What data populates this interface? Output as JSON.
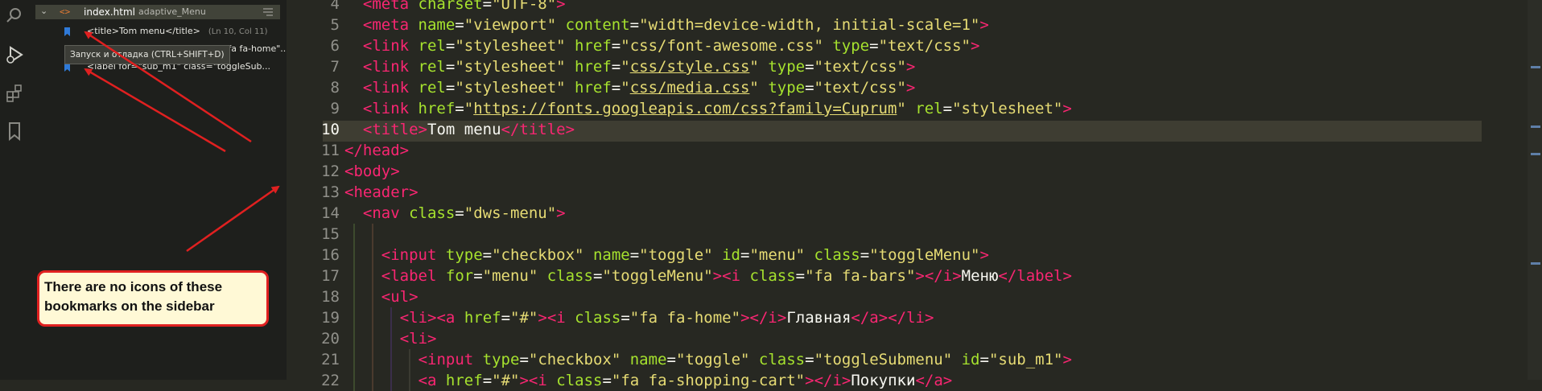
{
  "activity_bar": {
    "icons": [
      "search-icon",
      "run-debug-icon",
      "extensions-icon",
      "bookmarks-icon"
    ]
  },
  "bookmarks_panel": {
    "file": {
      "name": "index.html",
      "folder": "adaptive_Menu"
    },
    "items": [
      {
        "text": "<title>Tom menu</title>",
        "location": "(Ln 10, Col 11)"
      },
      {
        "text": "<i class=\"fa fa-home\"..."
      },
      {
        "text": "<label for=\"sub_m1\" class=\"toggleSub..."
      }
    ],
    "tooltip": "Запуск и отладка (CTRL+SHIFT+D)"
  },
  "annotation": {
    "callout_text": "There are no icons of these bookmarks on the sidebar"
  },
  "editor": {
    "current_line": 10,
    "line_numbers": [
      "4",
      "5",
      "6",
      "7",
      "8",
      "9",
      "10",
      "11",
      "12",
      "13",
      "14",
      "15",
      "16",
      "17",
      "18",
      "19",
      "20",
      "21",
      "22"
    ],
    "lines": [
      [
        [
          "t",
          "<meta "
        ],
        [
          "a",
          "charset"
        ],
        [
          "",
          "="
        ],
        [
          "s",
          "\"UTF-8\""
        ],
        [
          "t",
          ">"
        ]
      ],
      [
        [
          "t",
          "<meta "
        ],
        [
          "a",
          "name"
        ],
        [
          "",
          "="
        ],
        [
          "s",
          "\"viewport\" "
        ],
        [
          "a",
          "content"
        ],
        [
          "",
          "="
        ],
        [
          "s",
          "\"width=device-width, initial-scale=1\""
        ],
        [
          "t",
          ">"
        ]
      ],
      [
        [
          "t",
          "<link "
        ],
        [
          "a",
          "rel"
        ],
        [
          "",
          "="
        ],
        [
          "s",
          "\"stylesheet\" "
        ],
        [
          "a",
          "href"
        ],
        [
          "",
          "="
        ],
        [
          "s",
          "\"css/font-awesome.css\" "
        ],
        [
          "a",
          "type"
        ],
        [
          "",
          "="
        ],
        [
          "s",
          "\"text/css\""
        ],
        [
          "t",
          ">"
        ]
      ],
      [
        [
          "t",
          "<link "
        ],
        [
          "a",
          "rel"
        ],
        [
          "",
          "="
        ],
        [
          "s",
          "\"stylesheet\" "
        ],
        [
          "a",
          "href"
        ],
        [
          "",
          "="
        ],
        [
          "s",
          "\""
        ],
        [
          "u",
          "css/style.css"
        ],
        [
          "s",
          "\" "
        ],
        [
          "a",
          "type"
        ],
        [
          "",
          "="
        ],
        [
          "s",
          "\"text/css\""
        ],
        [
          "t",
          ">"
        ]
      ],
      [
        [
          "t",
          "<link "
        ],
        [
          "a",
          "rel"
        ],
        [
          "",
          "="
        ],
        [
          "s",
          "\"stylesheet\" "
        ],
        [
          "a",
          "href"
        ],
        [
          "",
          "="
        ],
        [
          "s",
          "\""
        ],
        [
          "u",
          "css/media.css"
        ],
        [
          "s",
          "\" "
        ],
        [
          "a",
          "type"
        ],
        [
          "",
          "="
        ],
        [
          "s",
          "\"text/css\""
        ],
        [
          "t",
          ">"
        ]
      ],
      [
        [
          "t",
          "<link "
        ],
        [
          "a",
          "href"
        ],
        [
          "",
          "="
        ],
        [
          "s",
          "\""
        ],
        [
          "u",
          "https://fonts.googleapis.com/css?family=Cuprum"
        ],
        [
          "s",
          "\" "
        ],
        [
          "a",
          "rel"
        ],
        [
          "",
          "="
        ],
        [
          "s",
          "\"stylesheet\""
        ],
        [
          "t",
          ">"
        ]
      ],
      [
        [
          "t",
          "<"
        ],
        [
          "t",
          "title"
        ],
        [
          "t",
          ">"
        ],
        [
          "",
          "Tom menu"
        ],
        [
          "t",
          "</"
        ],
        [
          "t",
          "title"
        ],
        [
          "t",
          ">"
        ]
      ],
      [
        [
          "t",
          "</"
        ],
        [
          "t",
          "head"
        ],
        [
          "t",
          ">"
        ]
      ],
      [
        [
          "t",
          "<"
        ],
        [
          "t",
          "body"
        ],
        [
          "t",
          ">"
        ]
      ],
      [
        [
          "t",
          "<"
        ],
        [
          "t",
          "header"
        ],
        [
          "t",
          ">"
        ]
      ],
      [
        [
          "t",
          "<nav "
        ],
        [
          "a",
          "class"
        ],
        [
          "",
          "="
        ],
        [
          "s",
          "\"dws-menu\""
        ],
        [
          "t",
          ">"
        ]
      ],
      [],
      [
        [
          "t",
          "<input "
        ],
        [
          "a",
          "type"
        ],
        [
          "",
          "="
        ],
        [
          "s",
          "\"checkbox\" "
        ],
        [
          "a",
          "name"
        ],
        [
          "",
          "="
        ],
        [
          "s",
          "\"toggle\" "
        ],
        [
          "a",
          "id"
        ],
        [
          "",
          "="
        ],
        [
          "s",
          "\"menu\" "
        ],
        [
          "a",
          "class"
        ],
        [
          "",
          "="
        ],
        [
          "s",
          "\"toggleMenu\""
        ],
        [
          "t",
          ">"
        ]
      ],
      [
        [
          "t",
          "<label "
        ],
        [
          "a",
          "for"
        ],
        [
          "",
          "="
        ],
        [
          "s",
          "\"menu\" "
        ],
        [
          "a",
          "class"
        ],
        [
          "",
          "="
        ],
        [
          "s",
          "\"toggleMenu\""
        ],
        [
          "t",
          ">"
        ],
        [
          "t",
          "<i "
        ],
        [
          "a",
          "class"
        ],
        [
          "",
          "="
        ],
        [
          "s",
          "\"fa fa-bars\""
        ],
        [
          "t",
          ">"
        ],
        [
          "t",
          "</"
        ],
        [
          "t",
          "i"
        ],
        [
          "t",
          ">"
        ],
        [
          "",
          "Меню"
        ],
        [
          "t",
          "</"
        ],
        [
          "t",
          "label"
        ],
        [
          "t",
          ">"
        ]
      ],
      [
        [
          "t",
          "<"
        ],
        [
          "t",
          "ul"
        ],
        [
          "t",
          ">"
        ]
      ],
      [
        [
          "t",
          "<"
        ],
        [
          "t",
          "li"
        ],
        [
          "t",
          ">"
        ],
        [
          "t",
          "<a "
        ],
        [
          "a",
          "href"
        ],
        [
          "",
          "="
        ],
        [
          "s",
          "\"#\""
        ],
        [
          "t",
          ">"
        ],
        [
          "t",
          "<i "
        ],
        [
          "a",
          "class"
        ],
        [
          "",
          "="
        ],
        [
          "s",
          "\"fa fa-home\""
        ],
        [
          "t",
          ">"
        ],
        [
          "t",
          "</"
        ],
        [
          "t",
          "i"
        ],
        [
          "t",
          ">"
        ],
        [
          "",
          "Главная"
        ],
        [
          "t",
          "</"
        ],
        [
          "t",
          "a"
        ],
        [
          "t",
          ">"
        ],
        [
          "t",
          "</"
        ],
        [
          "t",
          "li"
        ],
        [
          "t",
          ">"
        ]
      ],
      [
        [
          "t",
          "<"
        ],
        [
          "t",
          "li"
        ],
        [
          "t",
          ">"
        ]
      ],
      [
        [
          "t",
          "<input "
        ],
        [
          "a",
          "type"
        ],
        [
          "",
          "="
        ],
        [
          "s",
          "\"checkbox\" "
        ],
        [
          "a",
          "name"
        ],
        [
          "",
          "="
        ],
        [
          "s",
          "\"toggle\" "
        ],
        [
          "a",
          "class"
        ],
        [
          "",
          "="
        ],
        [
          "s",
          "\"toggleSubmenu\" "
        ],
        [
          "a",
          "id"
        ],
        [
          "",
          "="
        ],
        [
          "s",
          "\"sub_m1\""
        ],
        [
          "t",
          ">"
        ]
      ],
      [
        [
          "t",
          "<a "
        ],
        [
          "a",
          "href"
        ],
        [
          "",
          "="
        ],
        [
          "s",
          "\"#\""
        ],
        [
          "t",
          ">"
        ],
        [
          "t",
          "<i "
        ],
        [
          "a",
          "class"
        ],
        [
          "",
          "="
        ],
        [
          "s",
          "\"fa fa-shopping-cart\""
        ],
        [
          "t",
          "></"
        ],
        [
          "t",
          "i"
        ],
        [
          "t",
          ">"
        ],
        [
          "",
          "Покупки"
        ],
        [
          "t",
          "</"
        ],
        [
          "t",
          "a"
        ],
        [
          "t",
          ">"
        ]
      ]
    ]
  },
  "colors": {
    "tag": "#f92672",
    "attribute": "#a6e22e",
    "string": "#e6db74",
    "background": "#272822",
    "annotation_red": "#e02020"
  }
}
